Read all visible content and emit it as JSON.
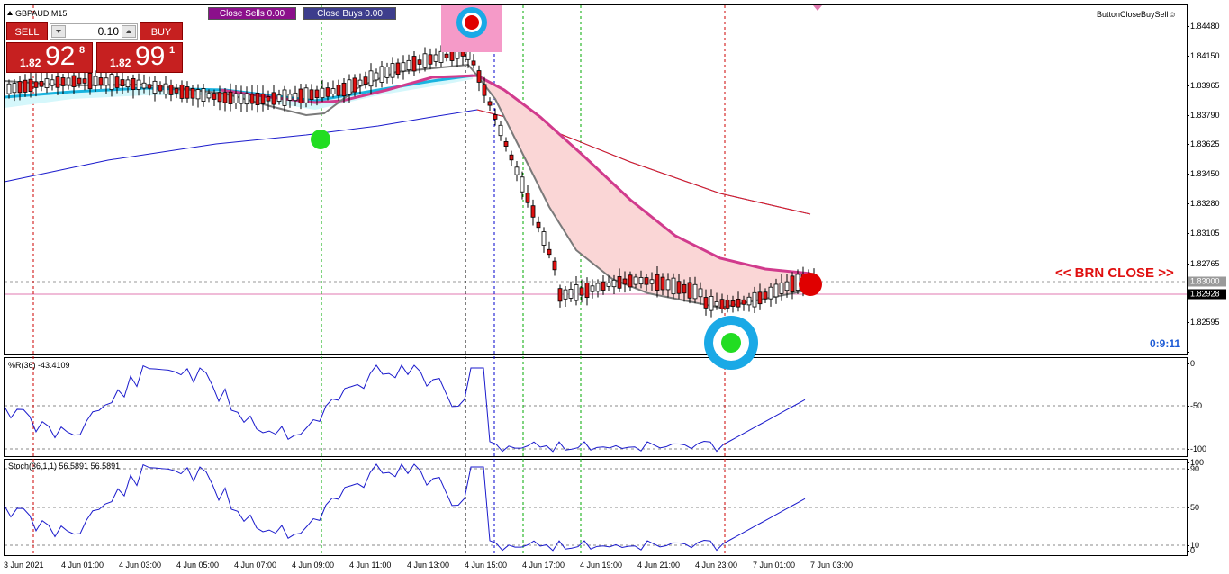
{
  "chart": {
    "symbol": "GBPAUD,M15",
    "ea_name": "ButtonCloseBuySell",
    "countdown": "0:9:11",
    "brn_close_label": "<< BRN CLOSE >>",
    "colors": {
      "bull_candle": "#ffffff",
      "bear_candle": "#e01010",
      "ma_fast": "#7a7a7a",
      "ma_slow_pink": "#d13b8d",
      "ma_long_red": "#e02020",
      "ma_long_blue": "#1a1acc",
      "cloud_fill": "#fad6d6",
      "band_fill": "#d5f7fb",
      "vline_red": "#cc0000",
      "vline_green": "#00aa00",
      "vline_blue": "#0000cc",
      "vline_black": "#000000"
    }
  },
  "buttons": {
    "close_sells": "Close Sells 0.00",
    "close_buys": "Close Buys 0.00"
  },
  "trade_panel": {
    "sell_label": "SELL",
    "buy_label": "BUY",
    "lot": "0.10",
    "sell_price_small": "1.82",
    "sell_price_big": "92",
    "sell_price_sup": "8",
    "buy_price_small": "1.82",
    "buy_price_big": "99",
    "buy_price_sup": "1"
  },
  "price_axis": {
    "ticks": [
      "1.84480",
      "1.84150",
      "1.83965",
      "1.83790",
      "1.83625",
      "1.83450",
      "1.83280",
      "1.83105",
      "1.82765",
      "1.82595"
    ],
    "tag_level": "1.83000",
    "tag_bid": "1.82928"
  },
  "wpr": {
    "label": "%R(36) -43.4109",
    "ticks": [
      "0",
      "-50",
      "-100"
    ]
  },
  "stoch": {
    "label": "Stoch(36,1,1) 56.5891 56.5891",
    "ticks": [
      "100",
      "90",
      "50",
      "10",
      "0"
    ]
  },
  "time_axis": [
    "3 Jun 2021",
    "4 Jun 01:00",
    "4 Jun 03:00",
    "4 Jun 05:00",
    "4 Jun 07:00",
    "4 Jun 09:00",
    "4 Jun 11:00",
    "4 Jun 13:00",
    "4 Jun 15:00",
    "4 Jun 17:00",
    "4 Jun 19:00",
    "4 Jun 21:00",
    "4 Jun 23:00",
    "7 Jun 01:00",
    "7 Jun 03:00"
  ],
  "icons": {
    "sell_signal": "red-dot-target-icon",
    "buy_signal": "green-dot-target-icon",
    "close_signal": "red-dot-icon"
  }
}
